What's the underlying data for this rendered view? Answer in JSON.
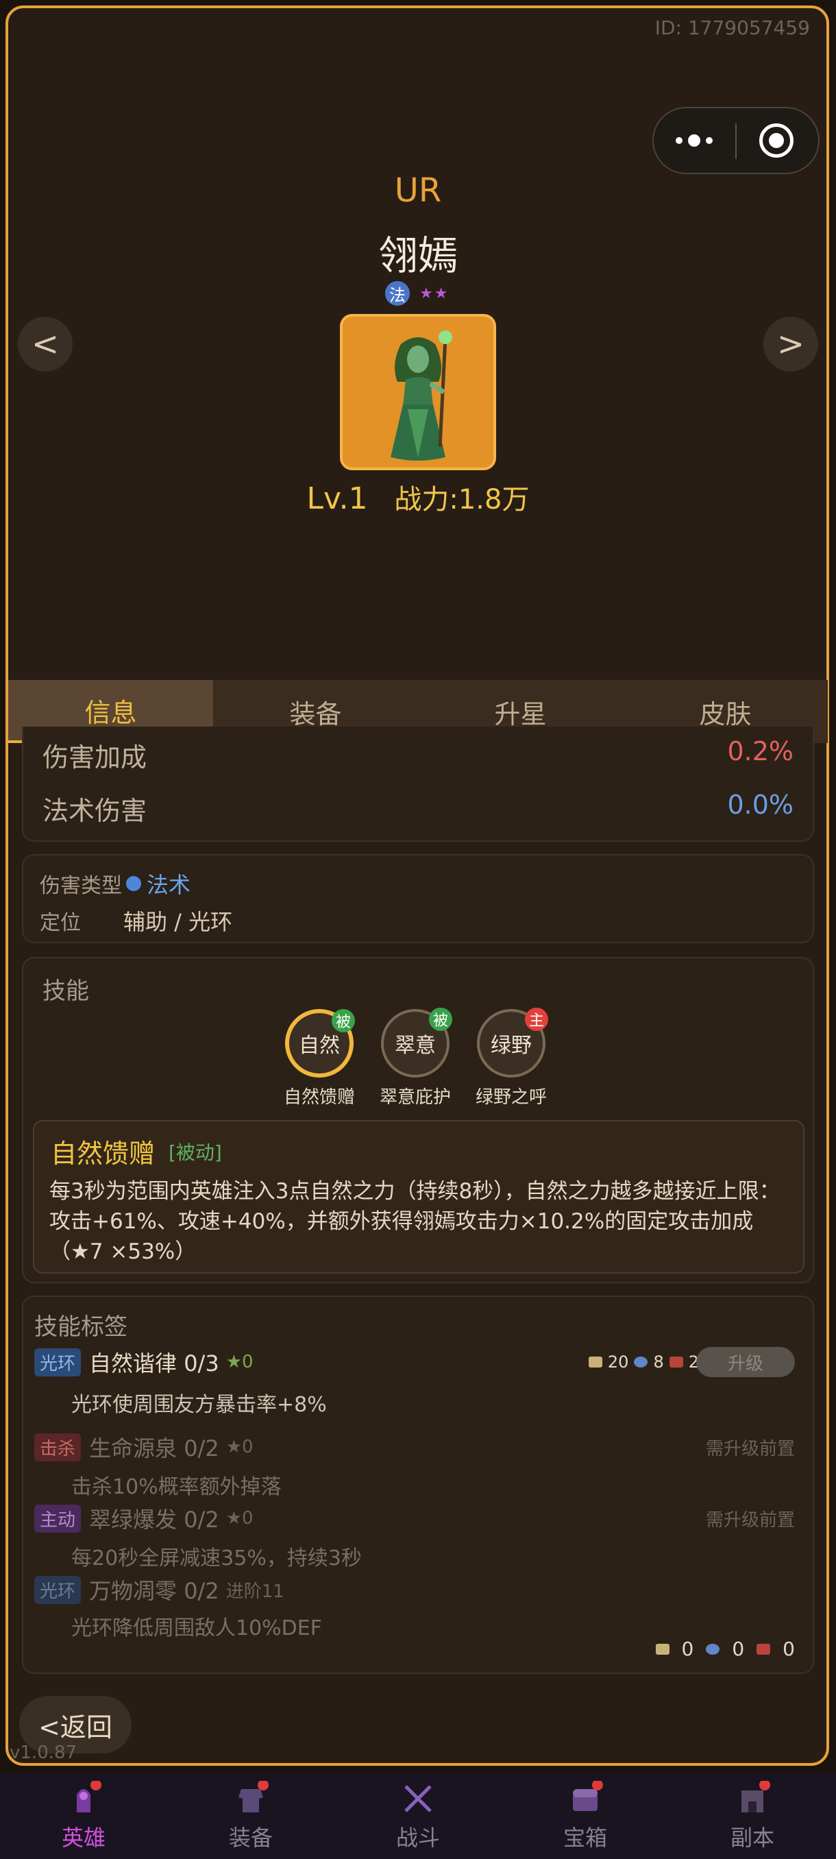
{
  "player_id": "ID: 1779057459",
  "hero": {
    "rarity": "UR",
    "name": "翎嫣",
    "class_badge": "法",
    "stars": "★★",
    "level": "Lv.1",
    "power": "战力:1.8万",
    "nav_prev": "<",
    "nav_next": ">"
  },
  "tabs": [
    "信息",
    "装备",
    "升星",
    "皮肤"
  ],
  "stats": [
    {
      "label": "伤害加成",
      "value": "0.2%",
      "color": "#e46060"
    },
    {
      "label": "法术伤害",
      "value": "0.0%",
      "color": "#6b9de6"
    }
  ],
  "damage_type": {
    "label": "伤害类型",
    "value": "法术",
    "role_label": "定位",
    "role_value": "辅助 / 光环"
  },
  "skills": {
    "title": "技能",
    "items": [
      {
        "icon_text": "自然",
        "tag": "被",
        "name": "自然馈赠"
      },
      {
        "icon_text": "翠意",
        "tag": "被",
        "name": "翠意庇护"
      },
      {
        "icon_text": "绿野",
        "tag": "主",
        "name": "绿野之呼"
      }
    ],
    "detail": {
      "title": "自然馈赠",
      "kind": "[被动]",
      "text": "每3秒为范围内英雄注入3点自然之力（持续8秒），自然之力越多越接近上限：攻击+61%、攻速+40%，并额外获得翎嫣攻击力×10.2%的固定攻击加成 （★7 ×53%）"
    }
  },
  "skill_tags": {
    "title": "技能标签",
    "rows": [
      {
        "chip": "光环",
        "name": "自然谐律 0/3",
        "star": "★0",
        "desc": "光环使周围友方暴击率+8%",
        "costs": [
          "20",
          "8",
          "2"
        ],
        "button": "升级"
      },
      {
        "chip": "击杀",
        "name": "生命源泉 0/2",
        "star": "★0",
        "desc": "击杀10%概率额外掉落",
        "req": "需升级前置"
      },
      {
        "chip": "主动",
        "name": "翠绿爆发 0/2",
        "star": "★0",
        "desc": "每20秒全屏减速35%，持续3秒",
        "req": "需升级前置"
      },
      {
        "chip": "光环",
        "name": "万物凋零 0/2",
        "star": "进阶11",
        "desc": "光环降低周围敌人10%DEF"
      }
    ],
    "totals": [
      "0",
      "0",
      "0"
    ]
  },
  "back_label": "<返回",
  "version": "v1.0.87",
  "navbar": [
    {
      "label": "英雄",
      "active": true,
      "dot": true
    },
    {
      "label": "装备",
      "active": false,
      "dot": true
    },
    {
      "label": "战斗",
      "active": false,
      "dot": false
    },
    {
      "label": "宝箱",
      "active": false,
      "dot": true
    },
    {
      "label": "副本",
      "active": false,
      "dot": true
    }
  ],
  "colors": {
    "accent": "#e8a23c",
    "frame": "#271d14",
    "active_nav": "#d050e0"
  }
}
